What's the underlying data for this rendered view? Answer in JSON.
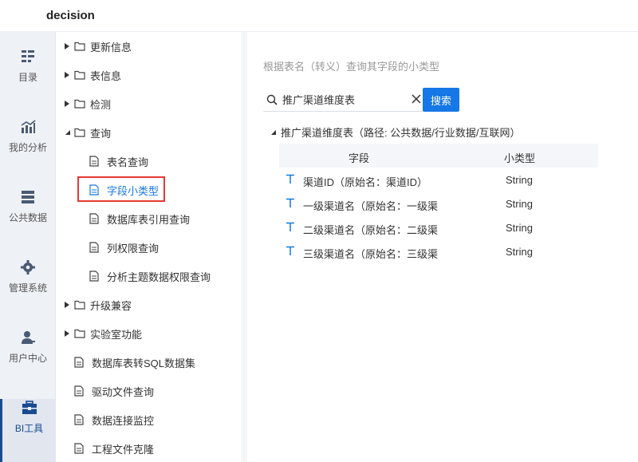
{
  "app": {
    "title": "decision"
  },
  "leftnav": [
    {
      "label": "目录",
      "icon": "directory-icon",
      "active": false
    },
    {
      "label": "我的分析",
      "icon": "chart-icon",
      "active": false
    },
    {
      "label": "公共数据",
      "icon": "database-icon",
      "active": false
    },
    {
      "label": "管理系统",
      "icon": "gear-icon",
      "active": false
    },
    {
      "label": "用户中心",
      "icon": "user-icon",
      "active": false
    },
    {
      "label": "BI工具",
      "icon": "toolbox-icon",
      "active": true
    }
  ],
  "tree": {
    "items": [
      {
        "label": "更新信息",
        "type": "folder",
        "expanded": false
      },
      {
        "label": "表信息",
        "type": "folder",
        "expanded": false
      },
      {
        "label": "检测",
        "type": "folder",
        "expanded": false
      },
      {
        "label": "查询",
        "type": "folder",
        "expanded": true
      },
      {
        "label": "表名查询",
        "type": "doc",
        "child": true
      },
      {
        "label": "字段小类型",
        "type": "doc",
        "child": true,
        "selected": true
      },
      {
        "label": "数据库表引用查询",
        "type": "doc",
        "child": true
      },
      {
        "label": "列权限查询",
        "type": "doc",
        "child": true
      },
      {
        "label": "分析主题数据权限查询",
        "type": "doc",
        "child": true
      },
      {
        "label": "升级兼容",
        "type": "folder",
        "expanded": false
      },
      {
        "label": "实验室功能",
        "type": "folder",
        "expanded": false
      },
      {
        "label": "数据库表转SQL数据集",
        "type": "doc"
      },
      {
        "label": "驱动文件查询",
        "type": "doc"
      },
      {
        "label": "数据连接监控",
        "type": "doc"
      },
      {
        "label": "工程文件克隆",
        "type": "doc"
      }
    ]
  },
  "main": {
    "description": "根据表名（转义）查询其字段的小类型",
    "search": {
      "value": "推广渠道维度表",
      "button_label": "搜索"
    },
    "result": {
      "table_label": "推广渠道维度表（路径: 公共数据/行业数据/互联网）",
      "columns": [
        "字段",
        "小类型"
      ],
      "rows": [
        {
          "field": "渠道ID（原始名：渠道ID）",
          "type": "String"
        },
        {
          "field": "一级渠道名（原始名：一级渠...",
          "type": "String"
        },
        {
          "field": "二级渠道名（原始名：二级渠...",
          "type": "String"
        },
        {
          "field": "三级渠道名（原始名：三级渠...",
          "type": "String"
        }
      ]
    }
  },
  "colors": {
    "accent": "#1677e6",
    "nav_active": "#1a4a8f",
    "highlight": "#e53935"
  }
}
